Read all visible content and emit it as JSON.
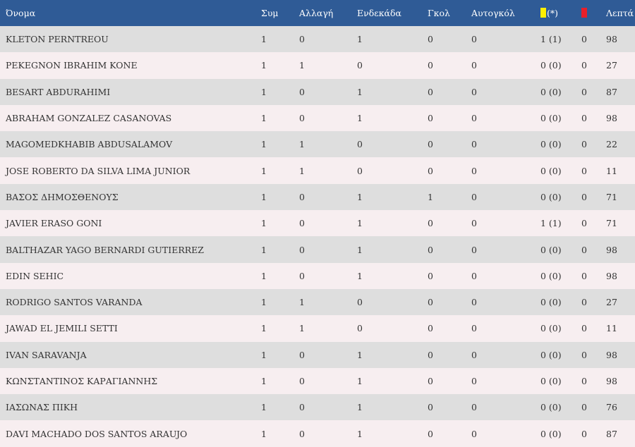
{
  "table": {
    "headers": {
      "name": "Όνομα",
      "apps": "Συμ",
      "sub": "Αλλαγή",
      "start": "Ενδεκάδα",
      "goals": "Γκολ",
      "own_goals": "Αυτογκόλ",
      "yellow_suffix": "(*)",
      "minutes": "Λεπτά"
    },
    "colors": {
      "header_bg": "#2f5b96",
      "row_odd": "#dedede",
      "row_even": "#f7eef0",
      "yellow_card": "#ffee00",
      "red_card": "#e8202a"
    },
    "icons": {
      "yellow": "yellow-card-icon",
      "red": "red-card-icon"
    },
    "rows": [
      {
        "name": "KLETON PERNTREOU",
        "apps": "1",
        "sub": "0",
        "start": "1",
        "goals": "0",
        "own_goals": "0",
        "yellow": "1 (1)",
        "red": "0",
        "minutes": "98"
      },
      {
        "name": "PEKEGNON IBRAHIM KONE",
        "apps": "1",
        "sub": "1",
        "start": "0",
        "goals": "0",
        "own_goals": "0",
        "yellow": "0 (0)",
        "red": "0",
        "minutes": "27"
      },
      {
        "name": "BESART ABDURAHIMI",
        "apps": "1",
        "sub": "0",
        "start": "1",
        "goals": "0",
        "own_goals": "0",
        "yellow": "0 (0)",
        "red": "0",
        "minutes": "87"
      },
      {
        "name": "ABRAHAM GONZALEZ CASANOVAS",
        "apps": "1",
        "sub": "0",
        "start": "1",
        "goals": "0",
        "own_goals": "0",
        "yellow": "0 (0)",
        "red": "0",
        "minutes": "98"
      },
      {
        "name": "MAGOMEDKHABIB ABDUSALAMOV",
        "apps": "1",
        "sub": "1",
        "start": "0",
        "goals": "0",
        "own_goals": "0",
        "yellow": "0 (0)",
        "red": "0",
        "minutes": "22"
      },
      {
        "name": "JOSE ROBERTO DA SILVA LIMA JUNIOR",
        "apps": "1",
        "sub": "1",
        "start": "0",
        "goals": "0",
        "own_goals": "0",
        "yellow": "0 (0)",
        "red": "0",
        "minutes": "11"
      },
      {
        "name": "ΒΑΣΟΣ ΔΗΜΟΣΘΕΝΟΥΣ",
        "apps": "1",
        "sub": "0",
        "start": "1",
        "goals": "1",
        "own_goals": "0",
        "yellow": "0 (0)",
        "red": "0",
        "minutes": "71"
      },
      {
        "name": "JAVIER ERASO GONI",
        "apps": "1",
        "sub": "0",
        "start": "1",
        "goals": "0",
        "own_goals": "0",
        "yellow": "1 (1)",
        "red": "0",
        "minutes": "71"
      },
      {
        "name": "BALTHAZAR YAGO BERNARDI GUTIERREZ",
        "apps": "1",
        "sub": "0",
        "start": "1",
        "goals": "0",
        "own_goals": "0",
        "yellow": "0 (0)",
        "red": "0",
        "minutes": "98"
      },
      {
        "name": "EDIN SEHIC",
        "apps": "1",
        "sub": "0",
        "start": "1",
        "goals": "0",
        "own_goals": "0",
        "yellow": "0 (0)",
        "red": "0",
        "minutes": "98"
      },
      {
        "name": "RODRIGO SANTOS VARANDA",
        "apps": "1",
        "sub": "1",
        "start": "0",
        "goals": "0",
        "own_goals": "0",
        "yellow": "0 (0)",
        "red": "0",
        "minutes": "27"
      },
      {
        "name": "JAWAD EL JEMILI SETTI",
        "apps": "1",
        "sub": "1",
        "start": "0",
        "goals": "0",
        "own_goals": "0",
        "yellow": "0 (0)",
        "red": "0",
        "minutes": "11"
      },
      {
        "name": "IVAN SARAVANJA",
        "apps": "1",
        "sub": "0",
        "start": "1",
        "goals": "0",
        "own_goals": "0",
        "yellow": "0 (0)",
        "red": "0",
        "minutes": "98"
      },
      {
        "name": "ΚΩΝΣΤΑΝΤΙΝΟΣ ΚΑΡΑΓΙΑΝΝΗΣ",
        "apps": "1",
        "sub": "0",
        "start": "1",
        "goals": "0",
        "own_goals": "0",
        "yellow": "0 (0)",
        "red": "0",
        "minutes": "98"
      },
      {
        "name": "ΙΑΣΩΝΑΣ ΠΙΚΗ",
        "apps": "1",
        "sub": "0",
        "start": "1",
        "goals": "0",
        "own_goals": "0",
        "yellow": "0 (0)",
        "red": "0",
        "minutes": "76"
      },
      {
        "name": "DAVI MACHADO DOS SANTOS ARAUJO",
        "apps": "1",
        "sub": "0",
        "start": "1",
        "goals": "0",
        "own_goals": "0",
        "yellow": "0 (0)",
        "red": "0",
        "minutes": "87"
      }
    ]
  }
}
